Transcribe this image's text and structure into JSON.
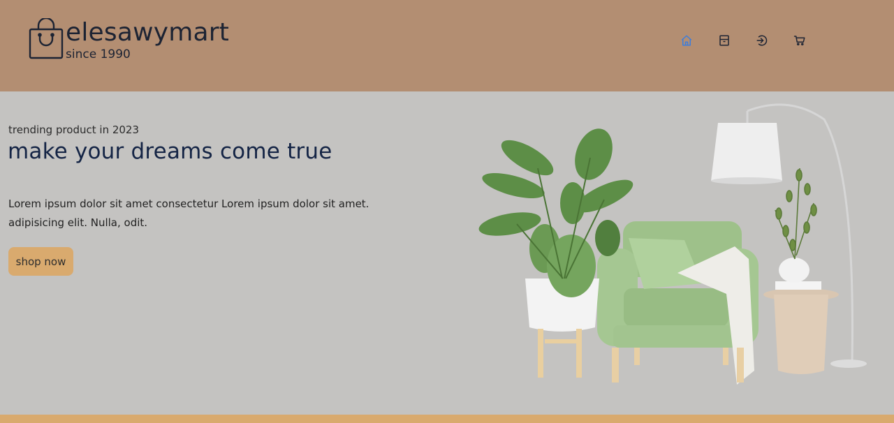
{
  "header": {
    "brand": "elesawymart",
    "since": "since 1990",
    "logo_icon": "shopping-bag-icon",
    "nav": [
      {
        "icon": "home-icon",
        "active": true
      },
      {
        "icon": "store-icon",
        "active": false
      },
      {
        "icon": "login-icon",
        "active": false
      },
      {
        "icon": "cart-icon",
        "active": false
      }
    ]
  },
  "hero": {
    "tagline": "trending product in 2023",
    "headline": "make your dreams come true",
    "description": "Lorem ipsum dolor sit amet consectetur Lorem ipsum dolor sit amet. adipisicing elit. Nulla, odit.",
    "button_label": "shop now",
    "image": "armchair-plant-lamp-illustration"
  },
  "colors": {
    "header_bg": "#b38e72",
    "hero_bg": "#c4c3c1",
    "accent": "#d9aa6e",
    "text_dark": "#142445",
    "nav_active": "#3b7ddd"
  }
}
